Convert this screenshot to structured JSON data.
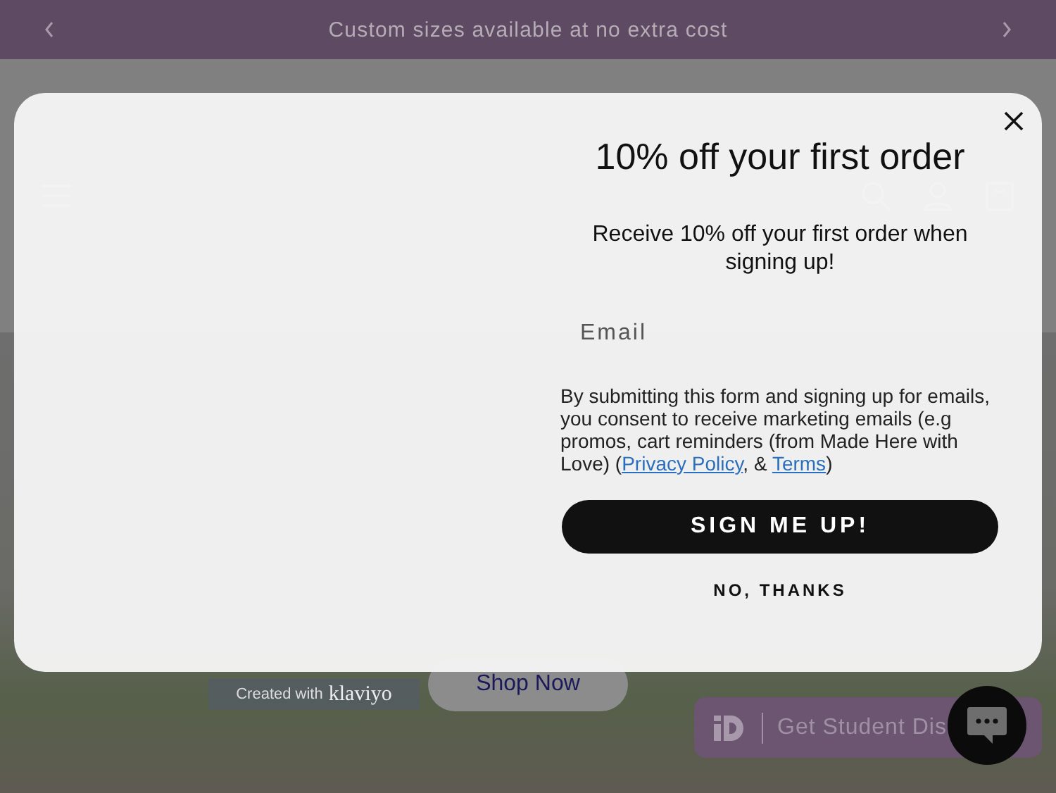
{
  "announcement": {
    "text": "Custom sizes available at no extra cost"
  },
  "hero": {
    "button": "Shop Now"
  },
  "popup": {
    "title": "10% off your first order",
    "subtitle": "Receive 10% off your first order when signing up!",
    "email": {
      "placeholder": "Email"
    },
    "consent": [
      {
        "kind": "text",
        "text": "By submitting this form and signing up for emails, you consent to receive marketing emails (e.g promos, cart reminders (from Made Here with Love) ("
      },
      {
        "kind": "link",
        "text": "Privacy Policy"
      },
      {
        "kind": "text",
        "text": ", & "
      },
      {
        "kind": "link",
        "text": "Terms"
      },
      {
        "kind": "text",
        "text": ")"
      }
    ],
    "primary_button": "SIGN ME UP!",
    "secondary_button": "NO, THANKS"
  },
  "badge": {
    "text": "Created with",
    "brand": "klaviyo"
  },
  "student_widget": {
    "text": "Get Student Dis"
  }
}
